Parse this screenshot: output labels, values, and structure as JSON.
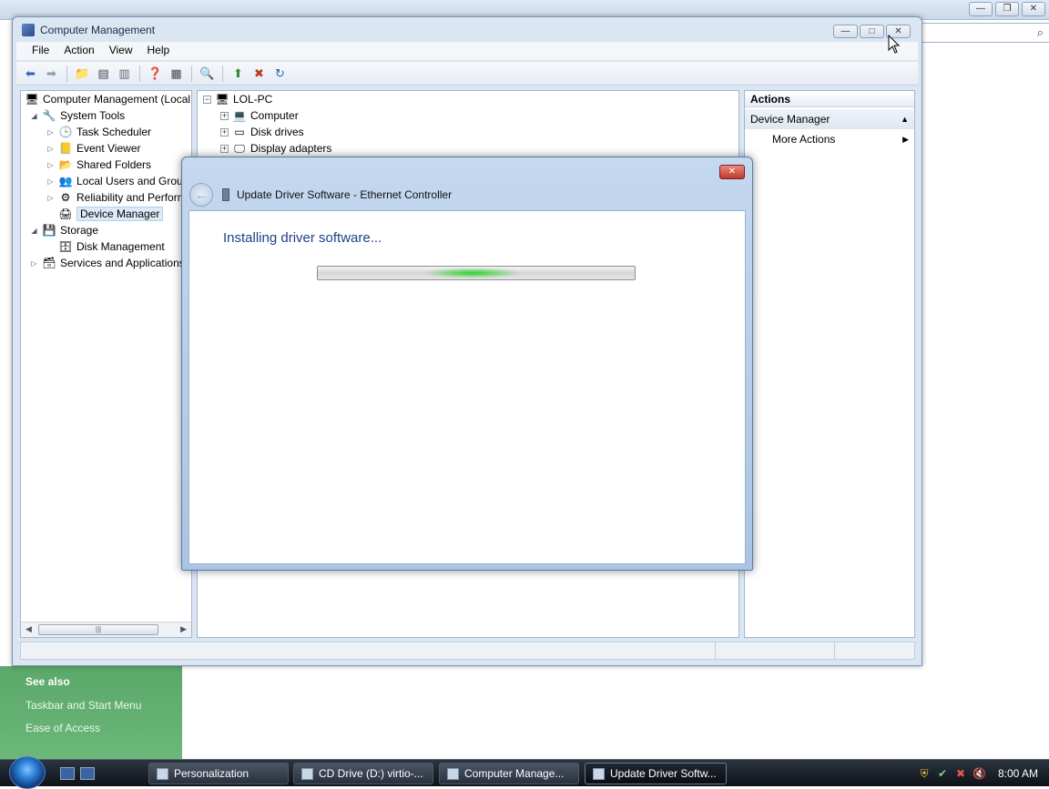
{
  "background_window": {
    "see_also_heading": "See also",
    "links": [
      "Taskbar and Start Menu",
      "Ease of Access"
    ],
    "controls": [
      "—",
      "❐",
      "✕"
    ]
  },
  "cm_window": {
    "title": "Computer Management",
    "controls": [
      "—",
      "□",
      "✕"
    ],
    "menu": [
      "File",
      "Action",
      "View",
      "Help"
    ],
    "tree_left": [
      {
        "label": "Computer Management (Local",
        "indent": 0,
        "expander": "",
        "icon": "computer-management-icon"
      },
      {
        "label": "System Tools",
        "indent": 1,
        "expander": "◢",
        "icon": "tools-icon"
      },
      {
        "label": "Task Scheduler",
        "indent": 2,
        "expander": "▷",
        "icon": "clock-icon"
      },
      {
        "label": "Event Viewer",
        "indent": 2,
        "expander": "▷",
        "icon": "event-viewer-icon"
      },
      {
        "label": "Shared Folders",
        "indent": 2,
        "expander": "▷",
        "icon": "shared-folder-icon"
      },
      {
        "label": "Local Users and Group",
        "indent": 2,
        "expander": "▷",
        "icon": "users-icon"
      },
      {
        "label": "Reliability and Perform",
        "indent": 2,
        "expander": "▷",
        "icon": "reliability-icon"
      },
      {
        "label": "Device Manager",
        "indent": 2,
        "expander": "",
        "icon": "device-manager-icon",
        "selected": true
      },
      {
        "label": "Storage",
        "indent": 1,
        "expander": "◢",
        "icon": "storage-icon"
      },
      {
        "label": "Disk Management",
        "indent": 2,
        "expander": "",
        "icon": "disk-management-icon"
      },
      {
        "label": "Services and Applications",
        "indent": 1,
        "expander": "▷",
        "icon": "services-icon"
      }
    ],
    "tree_mid": [
      {
        "label": "LOL-PC",
        "indent": 0,
        "expander": "−",
        "icon": "pc-icon"
      },
      {
        "label": "Computer",
        "indent": 1,
        "expander": "+",
        "icon": "computer-icon"
      },
      {
        "label": "Disk drives",
        "indent": 1,
        "expander": "+",
        "icon": "disk-drive-icon"
      },
      {
        "label": "Display adapters",
        "indent": 1,
        "expander": "+",
        "icon": "display-adapter-icon"
      }
    ],
    "actions": {
      "heading": "Actions",
      "section": "Device Manager",
      "more": "More Actions"
    },
    "scroll_thumb": "|||"
  },
  "wizard": {
    "title": "Update Driver Software - Ethernet Controller",
    "close_label": "✕",
    "heading": "Installing driver software...",
    "back_label": "←"
  },
  "taskbar": {
    "tasks": [
      {
        "label": "Personalization",
        "active": false
      },
      {
        "label": "CD Drive (D:) virtio-...",
        "active": false
      },
      {
        "label": "Computer Manage...",
        "active": false
      },
      {
        "label": "Update Driver Softw...",
        "active": true
      }
    ],
    "clock": "8:00 AM"
  }
}
